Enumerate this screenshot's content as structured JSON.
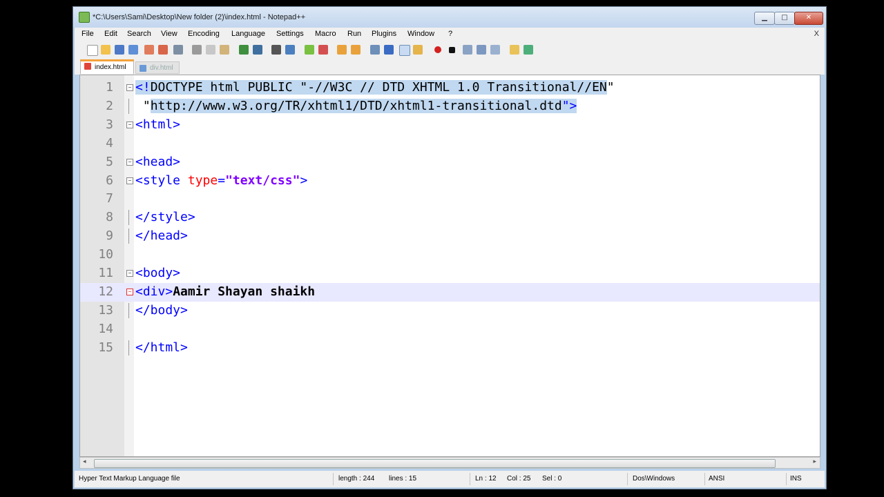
{
  "window": {
    "title": "*C:\\Users\\Sami\\Desktop\\New folder (2)\\index.html - Notepad++",
    "minimize_glyph": "▁",
    "maximize_glyph": "□",
    "close_glyph": "✕"
  },
  "menubar": {
    "items": [
      "File",
      "Edit",
      "Search",
      "View",
      "Encoding",
      "Language",
      "Settings",
      "Macro",
      "Run",
      "Plugins",
      "Window",
      "?"
    ],
    "close_label": "X"
  },
  "tabs": [
    {
      "label": "index.html",
      "active": true,
      "icon_color": "#e0453a"
    },
    {
      "label": "div.html",
      "active": false,
      "icon_color": "#6a9ad6"
    }
  ],
  "editor": {
    "lines": [
      {
        "n": "1",
        "tokens": [
          [
            "tag sel",
            "<!"
          ],
          [
            "doc sel",
            "DOCTYPE html PUBLIC \""
          ],
          [
            "doc sel",
            "-//W3C // DTD XHTML 1.0 Transitional//EN"
          ],
          [
            "doc",
            "\""
          ]
        ],
        "fold": "minus"
      },
      {
        "n": "2",
        "tokens": [
          [
            "doc",
            " \""
          ],
          [
            "doc sel",
            "http://www.w3.org/TR/xhtml1/DTD/xhtml1-transitional.dtd"
          ],
          [
            "tag sel",
            "\">"
          ]
        ],
        "fold": "tick"
      },
      {
        "n": "3",
        "tokens": [
          [
            "tag",
            "<html>"
          ]
        ],
        "fold": "minus"
      },
      {
        "n": "4",
        "tokens": [],
        "fold": "none"
      },
      {
        "n": "5",
        "tokens": [
          [
            "tag",
            "<head>"
          ]
        ],
        "fold": "minus"
      },
      {
        "n": "6",
        "tokens": [
          [
            "tag",
            "<style "
          ],
          [
            "attr",
            "type"
          ],
          [
            "tag",
            "="
          ],
          [
            "str",
            "\"text/css\""
          ],
          [
            "tag",
            ">"
          ]
        ],
        "fold": "minus"
      },
      {
        "n": "7",
        "tokens": [],
        "fold": "none"
      },
      {
        "n": "8",
        "tokens": [
          [
            "tag",
            "</style>"
          ]
        ],
        "fold": "tick"
      },
      {
        "n": "9",
        "tokens": [
          [
            "tag",
            "</head>"
          ]
        ],
        "fold": "tick"
      },
      {
        "n": "10",
        "tokens": [],
        "fold": "none"
      },
      {
        "n": "11",
        "tokens": [
          [
            "tag",
            "<body>"
          ]
        ],
        "fold": "minus"
      },
      {
        "n": "12",
        "tokens": [
          [
            "tag",
            "<div>"
          ],
          [
            "txt",
            "Aamir Shayan shaikh"
          ]
        ],
        "fold": "minus-red"
      },
      {
        "n": "13",
        "tokens": [
          [
            "tag",
            "</body>"
          ]
        ],
        "fold": "tick"
      },
      {
        "n": "14",
        "tokens": [],
        "fold": "none"
      },
      {
        "n": "15",
        "tokens": [
          [
            "tag",
            "</html>"
          ]
        ],
        "fold": "tick"
      }
    ],
    "current_line": 12
  },
  "statusbar": {
    "file_type": "Hyper Text Markup Language file",
    "length": "length : 244",
    "lines": "lines : 15",
    "ln": "Ln : 12",
    "col": "Col : 25",
    "sel": "Sel : 0",
    "eol": "Dos\\Windows",
    "encoding": "ANSI",
    "mode": "INS"
  }
}
